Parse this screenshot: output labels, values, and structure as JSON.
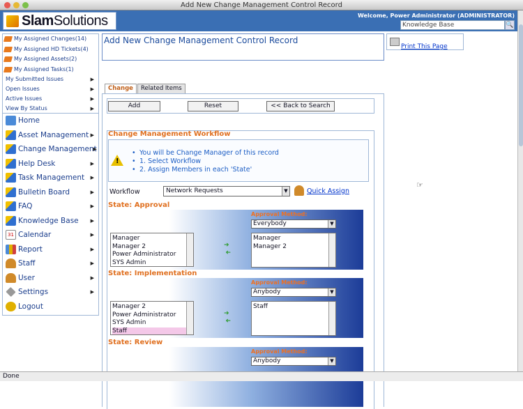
{
  "window": {
    "title": "Add New Change Management Control Record"
  },
  "header": {
    "logo_brand": "Slam",
    "logo_suffix": "Solutions",
    "welcome": "Welcome, Power Administrator (ADMINISTRATOR)",
    "kb_search_value": "Knowledge Base"
  },
  "sidebar": {
    "quick_links": [
      "My Assigned Changes(14)",
      "My Assigned HD Tickets(4)",
      "My Assigned Assets(2)",
      "My Assigned Tasks(1)"
    ],
    "quick_menus": [
      "My Submitted Issues",
      "Open Issues",
      "Active Issues",
      "View By Status"
    ],
    "menu": [
      {
        "label": "Home",
        "color": "#4a8ad8"
      },
      {
        "label": "Asset Management",
        "color": "#2f6fd0"
      },
      {
        "label": "Change Management",
        "color": "#2f6fd0"
      },
      {
        "label": "Help Desk",
        "color": "#2f6fd0"
      },
      {
        "label": "Task Management",
        "color": "#2f6fd0"
      },
      {
        "label": "Bulletin Board",
        "color": "#2f6fd0"
      },
      {
        "label": "FAQ",
        "color": "#2f6fd0"
      },
      {
        "label": "Knowledge Base",
        "color": "#2f6fd0"
      },
      {
        "label": "Calendar",
        "color": "#e8e8e8"
      },
      {
        "label": "Report",
        "color": "#4a8ad8"
      },
      {
        "label": "Staff",
        "color": "#d08a2a"
      },
      {
        "label": "User",
        "color": "#d08a2a"
      },
      {
        "label": "Settings",
        "color": "#999999"
      },
      {
        "label": "Logout",
        "color": "#e0b000"
      }
    ],
    "calendar_day": "31"
  },
  "main": {
    "title": "Add New Change Management Control Record",
    "tabs": [
      "Change",
      "Related Items"
    ],
    "buttons": {
      "add": "Add",
      "reset": "Reset",
      "back": "<< Back to Search"
    },
    "workflow_section_title": "Change Management Workflow",
    "info_lines": [
      "You will be Change Manager of this record",
      "1. Select Workflow",
      "2. Assign Members in each 'State'"
    ],
    "workflow_label": "Workflow",
    "workflow_value": "Network Requests",
    "quick_assign": "Quick Assign",
    "approval_method_label": "Approval Method:",
    "states": [
      {
        "title": "State: Approval",
        "approval_method": "Everybody",
        "available": [
          "Manager",
          "Manager 2",
          "Power Administrator",
          "SYS Admin"
        ],
        "assigned": [
          "Manager",
          "Manager 2"
        ]
      },
      {
        "title": "State: Implementation",
        "approval_method": "Anybody",
        "available": [
          "Manager 2",
          "Power Administrator",
          "SYS Admin",
          "Staff"
        ],
        "assigned": [
          "Staff"
        ]
      },
      {
        "title": "State: Review",
        "approval_method": "Anybody",
        "available": [],
        "assigned": []
      }
    ]
  },
  "print": {
    "label": "Print This Page"
  },
  "status": {
    "text": "Done"
  },
  "colors": {
    "header": "#3a6fb4",
    "section_title": "#e07020",
    "link": "#0033cc",
    "info_text": "#1a5cc4"
  }
}
